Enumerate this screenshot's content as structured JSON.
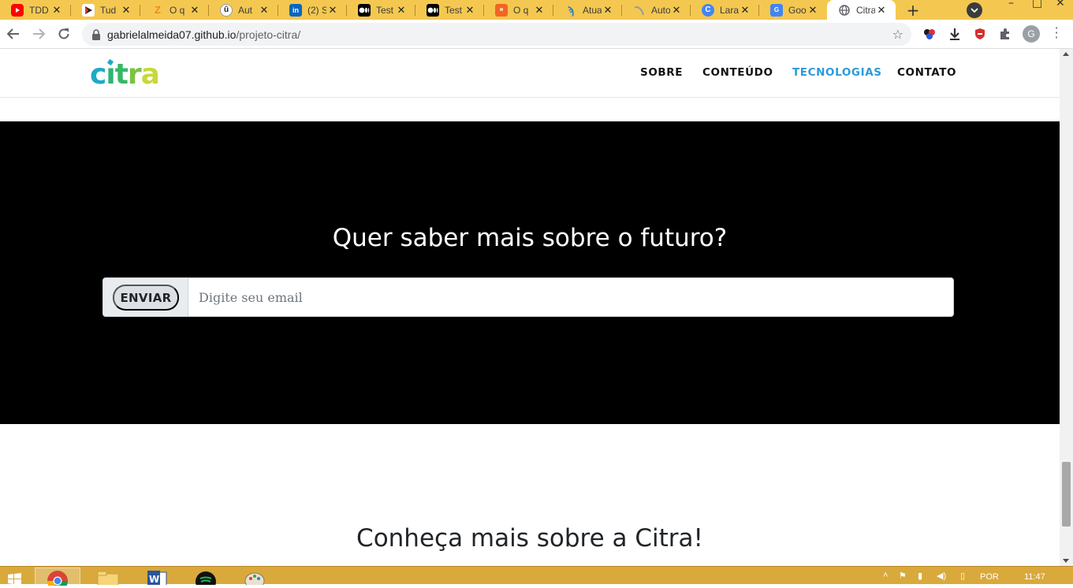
{
  "browser": {
    "tabs": [
      {
        "title": "TDD",
        "icon": "youtube-icon",
        "color": "#ff0000"
      },
      {
        "title": "Tud",
        "icon": "play-icon",
        "color": "#222222"
      },
      {
        "title": "O q",
        "icon": "z-icon",
        "color": "#f5a623"
      },
      {
        "title": "Aut",
        "icon": "udemy-icon",
        "color": "#222222"
      },
      {
        "title": "(2) S",
        "icon": "linkedin-icon",
        "color": "#0a66c2"
      },
      {
        "title": "Test",
        "icon": "medium-icon",
        "color": "#000000"
      },
      {
        "title": "Test",
        "icon": "medium-icon",
        "color": "#000000"
      },
      {
        "title": "O q",
        "icon": "site-icon",
        "color": "#f26522"
      },
      {
        "title": "Atua",
        "icon": "pycharm-icon",
        "color": "#2f80c8"
      },
      {
        "title": "Auto",
        "icon": "curve-icon",
        "color": "#999999"
      },
      {
        "title": "Lara",
        "icon": "c-icon",
        "color": "#4285f4"
      },
      {
        "title": "Goo",
        "icon": "translate-icon",
        "color": "#4285f4"
      },
      {
        "title": "Citra",
        "icon": "globe-icon",
        "color": "#5f6368",
        "active": true
      }
    ],
    "url_host": "gabrielalmeida07.github.io",
    "url_path": "/projeto-citra/",
    "profile_initial": "G",
    "accent_color": "#f4c850"
  },
  "site": {
    "logo_text": "citra",
    "nav": [
      {
        "label": "SOBRE"
      },
      {
        "label": "CONTEÚDO"
      },
      {
        "label": "TECNOLOGIAS",
        "active": true
      },
      {
        "label": "CONTATO"
      }
    ],
    "newsletter": {
      "heading": "Quer saber mais sobre o futuro?",
      "button_label": "ENVIAR",
      "email_placeholder": "Digite seu email",
      "email_value": ""
    },
    "about_heading": "Conheça mais sobre a Citra!",
    "active_nav_color": "#2c9ad8"
  },
  "taskbar": {
    "language": "POR",
    "time": "11:47"
  }
}
